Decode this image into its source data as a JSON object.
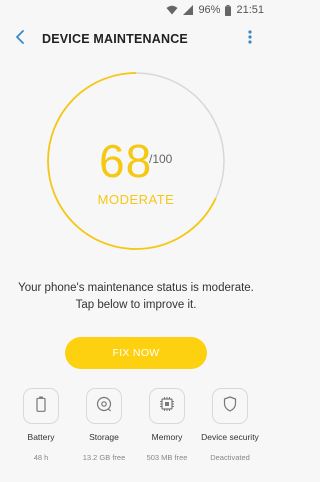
{
  "status_bar": {
    "battery": "96%",
    "time": "21:51"
  },
  "header": {
    "title": "DEVICE MAINTENANCE",
    "back_icon": "chevron-left-icon",
    "more_icon": "more-vert-icon"
  },
  "score": {
    "value": "68",
    "max": "/100",
    "status": "MODERATE",
    "ring_fraction": 0.68,
    "ring_color": "#f5c814",
    "track_color": "#d8d8d8"
  },
  "message": {
    "line1": "Your phone's maintenance status is moderate.",
    "line2": "Tap below to improve it."
  },
  "fix_button": {
    "label": "FIX NOW",
    "color": "#fdd10f"
  },
  "items": [
    {
      "label": "Battery",
      "value": "48 h",
      "icon": "battery-icon"
    },
    {
      "label": "Storage",
      "value": "13.2 GB free",
      "icon": "storage-icon"
    },
    {
      "label": "Memory",
      "value": "503 MB free",
      "icon": "memory-chip-icon"
    },
    {
      "label": "Device security",
      "value": "Deactivated",
      "icon": "shield-icon"
    }
  ]
}
